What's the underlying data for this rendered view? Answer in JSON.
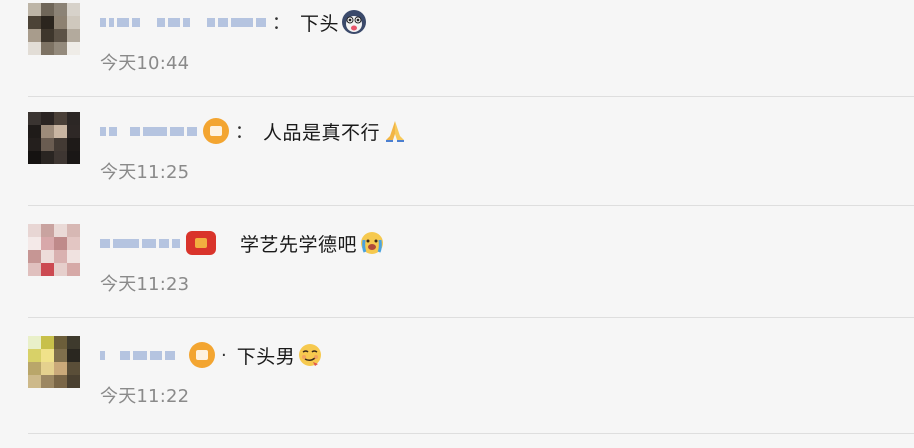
{
  "comments": [
    {
      "separator": "：",
      "text": "下头",
      "emoji": "dog-face-emoji",
      "time": "今天10:44",
      "badge_color": ""
    },
    {
      "separator": "：",
      "text": "人品是真不行",
      "emoji": "folded-hands-emoji",
      "time": "今天11:25",
      "badge_color": "#f3a531"
    },
    {
      "separator": "",
      "text": "学艺先学德吧",
      "emoji": "crying-face-emoji",
      "time": "今天11:23",
      "badge_color": "#d9342b"
    },
    {
      "separator": "·",
      "text": "下头男",
      "emoji": "smirk-face-emoji",
      "time": "今天11:22",
      "badge_color": "#f3a531"
    }
  ]
}
